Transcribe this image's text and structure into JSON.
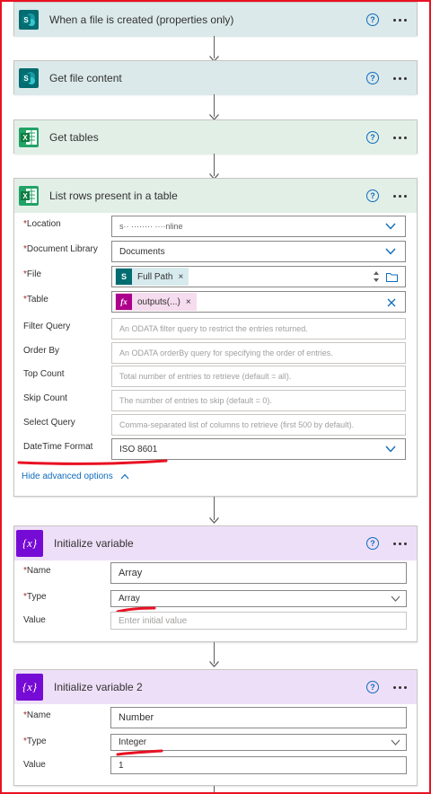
{
  "cards": {
    "trigger": {
      "title": "When a file is created (properties only)",
      "icon": "sharepoint-icon"
    },
    "get_content": {
      "title": "Get file content",
      "icon": "sharepoint-icon"
    },
    "get_tables": {
      "title": "Get tables",
      "icon": "excel-icon"
    },
    "list_rows": {
      "title": "List rows present in a table",
      "icon": "excel-icon",
      "fields": {
        "location": {
          "label": "Location",
          "value": "s·· ········ ····nline"
        },
        "document_library": {
          "label": "Document Library",
          "value": "Documents"
        },
        "file": {
          "label": "File",
          "token": "Full Path"
        },
        "table": {
          "label": "Table",
          "token": "outputs(...)"
        },
        "filter_query": {
          "label": "Filter Query",
          "placeholder": "An ODATA filter query to restrict the entries returned."
        },
        "order_by": {
          "label": "Order By",
          "placeholder": "An ODATA orderBy query for specifying the order of entries."
        },
        "top_count": {
          "label": "Top Count",
          "placeholder": "Total number of entries to retrieve (default = all)."
        },
        "skip_count": {
          "label": "Skip Count",
          "placeholder": "The number of entries to skip (default = 0)."
        },
        "select_query": {
          "label": "Select Query",
          "placeholder": "Comma-separated list of columns to retrieve (first 500 by default)."
        },
        "datetime_format": {
          "label": "DateTime Format",
          "value": "ISO 8601"
        }
      },
      "hide_advanced": "Hide advanced options"
    },
    "init_var": {
      "title": "Initialize variable",
      "icon": "variable-icon",
      "icon_text": "{x}",
      "name_label": "Name",
      "name_value": "Array",
      "type_label": "Type",
      "type_value": "Array",
      "value_label": "Value",
      "value_placeholder": "Enter initial value"
    },
    "init_var2": {
      "title": "Initialize variable 2",
      "icon": "variable-icon",
      "icon_text": "{x}",
      "name_label": "Name",
      "name_value": "Number",
      "type_label": "Type",
      "type_value": "Integer",
      "value_label": "Value",
      "value_value": "1"
    }
  },
  "common": {
    "required_mark": "*",
    "help_glyph": "?",
    "sp_letter": "S",
    "xl_letter": "X",
    "fx_glyph": "fx",
    "token_remove": "×"
  },
  "colors": {
    "sharepoint": "#036c70",
    "excel": "#21a366",
    "variable": "#770bd6",
    "link": "#0f6cbd",
    "annotation": "#e81123"
  }
}
